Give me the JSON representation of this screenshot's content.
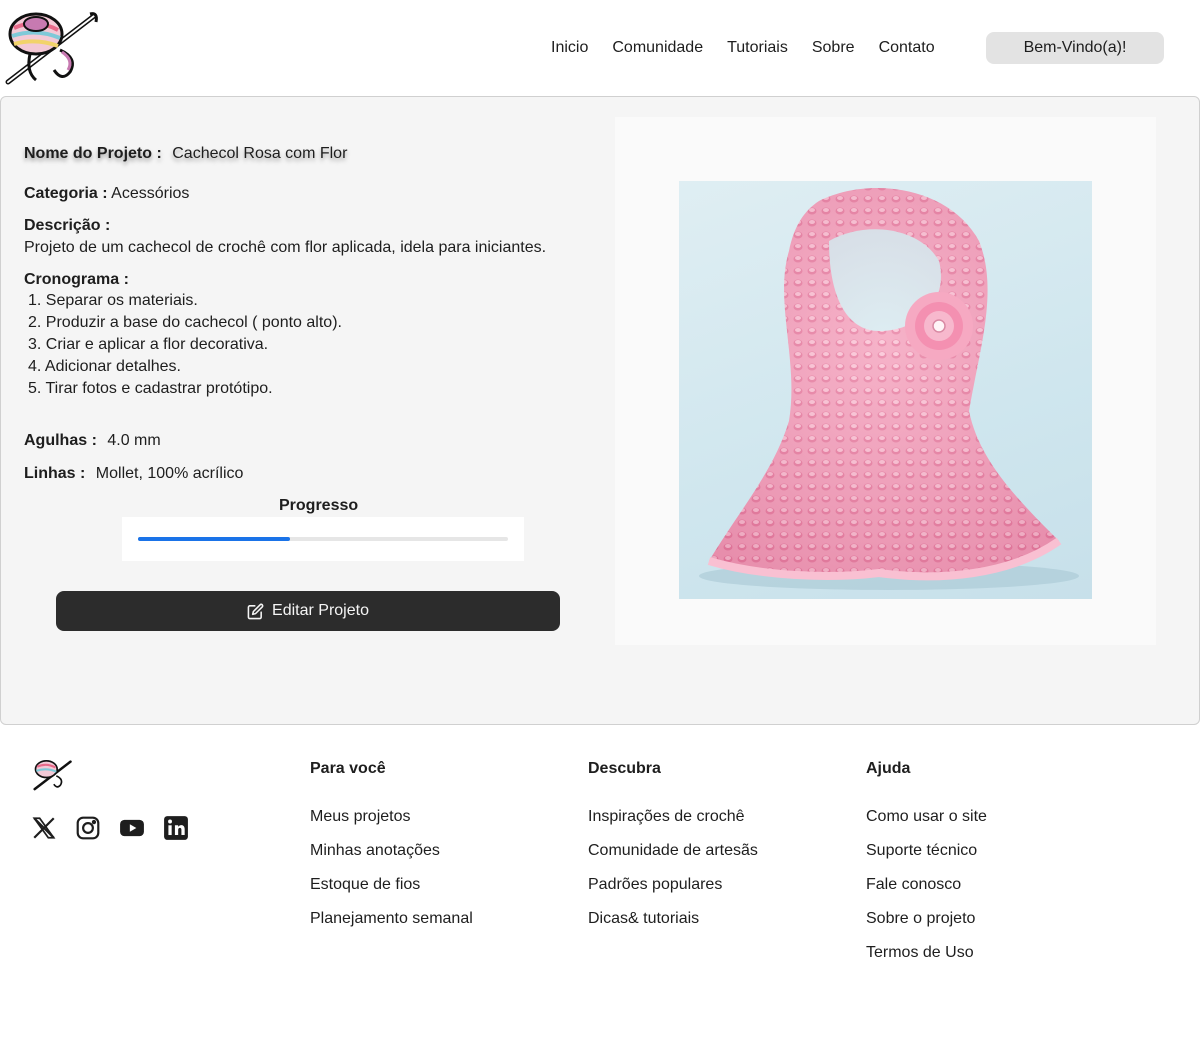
{
  "header": {
    "nav": [
      "Inicio",
      "Comunidade",
      "Tutoriais",
      "Sobre",
      "Contato"
    ],
    "welcome": "Bem-Vindo(a)!"
  },
  "project": {
    "name_label": "Nome do Projeto :",
    "name": "Cachecol Rosa com Flor",
    "category_label": "Categoria :",
    "category": "Acessórios",
    "description_label": "Descrição :",
    "description": "Projeto de um cachecol de crochê com flor aplicada, idela para iniciantes.",
    "schedule_label": "Cronograma :",
    "schedule": [
      "1.  Separar os materiais.",
      "2. Produzir a base do cachecol ( ponto alto).",
      "3. Criar e aplicar a flor decorativa.",
      "4. Adicionar detalhes.",
      "5. Tirar fotos e cadastrar protótipo."
    ],
    "needles_label": "Agulhas :",
    "needles": "4.0 mm",
    "threads_label": "Linhas :",
    "threads": "Mollet, 100% acrílico",
    "progress_label": "Progresso",
    "progress": 0.41,
    "edit_button": "Editar Projeto"
  },
  "colors": {
    "accent": "#1a73e8",
    "button": "#2c2c2c",
    "scarf": "#f29bb7"
  },
  "footer": {
    "social_icons": [
      "x-icon",
      "instagram-icon",
      "youtube-icon",
      "linkedin-icon"
    ],
    "columns": [
      {
        "title": "Para você",
        "links": [
          "Meus projetos",
          "Minhas anotações",
          "Estoque de fios",
          "Planejamento semanal"
        ]
      },
      {
        "title": "Descubra",
        "links": [
          "Inspirações de crochê",
          "Comunidade de artesãs",
          "Padrões populares",
          "Dicas& tutoriais"
        ]
      },
      {
        "title": "Ajuda",
        "links": [
          "Como usar o site",
          "Suporte técnico",
          "Fale conosco",
          "Sobre o projeto",
          "Termos de Uso"
        ]
      }
    ]
  }
}
